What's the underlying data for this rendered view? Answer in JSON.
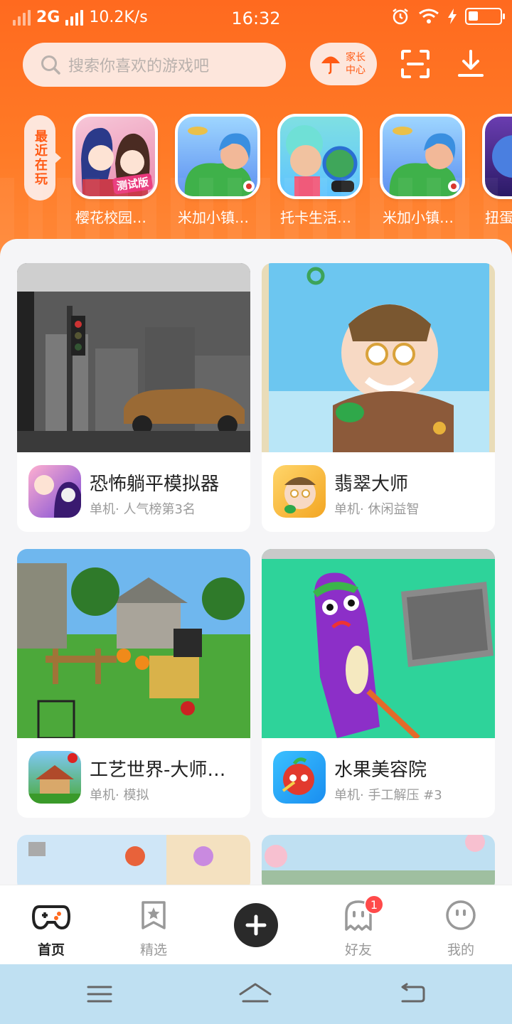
{
  "status_bar": {
    "network": "2G",
    "speed": "10.2K/s",
    "time": "16:32"
  },
  "search": {
    "placeholder": "搜索你喜欢的游戏吧"
  },
  "header": {
    "parent_center_label": "家长中心",
    "scan_icon": "scan-icon",
    "download_icon": "download-icon"
  },
  "recent": {
    "tag": "最近在玩",
    "items": [
      {
        "name": "樱花校园…",
        "badge": "测试版"
      },
      {
        "name": "米加小镇…"
      },
      {
        "name": "托卡生活…"
      },
      {
        "name": "米加小镇…"
      },
      {
        "name": "扭蛋…"
      }
    ]
  },
  "games": [
    {
      "name": "恐怖躺平模拟器",
      "sub": "单机· 人气榜第3名"
    },
    {
      "name": "翡翠大师",
      "sub": "单机· 休闲益智"
    },
    {
      "name": "工艺世界-大师…",
      "sub": "单机· 模拟"
    },
    {
      "name": "水果美容院",
      "sub": "单机· 手工解压 #3"
    }
  ],
  "tabs": {
    "home": "首页",
    "featured": "精选",
    "friends": "好友",
    "friends_badge": "1",
    "me": "我的"
  },
  "colors": {
    "accent": "#ff6a1f",
    "header_pill": "#fde6dc",
    "nav_bar": "#bfe0f2"
  }
}
